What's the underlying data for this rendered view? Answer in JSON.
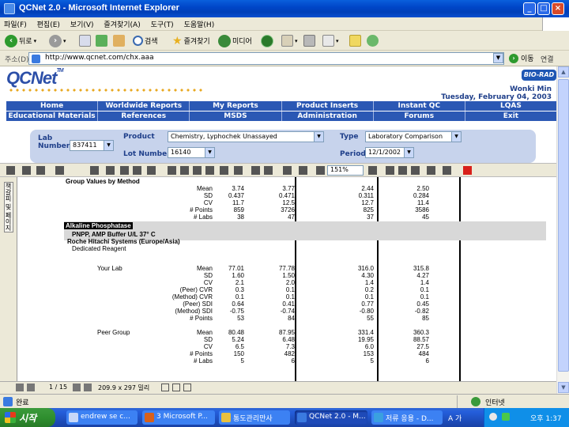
{
  "window": {
    "title": "QCNet 2.0 - Microsoft Internet Explorer"
  },
  "menu": [
    "파일(F)",
    "편집(E)",
    "보기(V)",
    "즐겨찾기(A)",
    "도구(T)",
    "도움말(H)"
  ],
  "toolbar": {
    "back": "뒤로",
    "search": "검색",
    "favorites": "즐겨찾기",
    "media": "미디어"
  },
  "address": {
    "label": "주소(D)",
    "url": "http://www.qcnet.com/chx.aaa",
    "go": "이동",
    "links": "연결"
  },
  "site": {
    "logo": "QCNet",
    "brand": "BIO-RAD",
    "user_name": "Wonki Min",
    "user_date": "Tuesday, February 04, 2003"
  },
  "nav1": [
    "Home",
    "Worldwide Reports",
    "My Reports",
    "Product Inserts",
    "Instant QC",
    "LQAS"
  ],
  "nav2": [
    "Educational Materials",
    "References",
    "MSDS",
    "Administration",
    "Forums",
    "Exit"
  ],
  "filter": {
    "lab_label": "Lab Number",
    "lab_value": "837411",
    "product_label": "Product",
    "product_value": "Chemistry, Lyphochek Unassayed",
    "lot_label": "Lot Number",
    "lot_value": "16140",
    "type_label": "Type",
    "type_value": "Laboratory Comparison",
    "period_label": "Period",
    "period_value": "12/1/2002"
  },
  "acro": {
    "zoom": "151%"
  },
  "bookmarks_tab": "책갈피 및 페이지",
  "report": {
    "group_header": "Group Values by Method",
    "top_stats": [
      "Mean",
      "SD",
      "CV",
      "# Points",
      "# Labs"
    ],
    "top_cols": [
      [
        "3.74",
        "0.437",
        "11.7",
        "859",
        "38"
      ],
      [
        "3.77",
        "0.471",
        "12.5",
        "3726",
        "47"
      ],
      [
        "2.44",
        "0.311",
        "12.7",
        "825",
        "37"
      ],
      [
        "2.50",
        "0.284",
        "11.4",
        "3586",
        "45"
      ]
    ],
    "analyte": "Alkaline Phosphatase",
    "method_line": "PNPP, AMP Buffer   U/L   37° C",
    "instrument": "Roche Hitachi Systems (Europe/Asia)",
    "reagent": "Dedicated Reagent",
    "your_lab_label": "Your Lab",
    "your_lab_stats": [
      "Mean",
      "SD",
      "CV",
      "(Peer) CVR",
      "(Method) CVR",
      "(Peer) SDI",
      "(Method) SDI",
      "# Points"
    ],
    "your_lab_cols": [
      [
        "77.01",
        "1.60",
        "2.1",
        "0.3",
        "0.1",
        "0.64",
        "-0.75",
        "53"
      ],
      [
        "77.78",
        "1.50",
        "2.0",
        "0.1",
        "0.1",
        "0.41",
        "-0.74",
        "84"
      ],
      [
        "316.0",
        "4.30",
        "1.4",
        "0.2",
        "0.1",
        "0.77",
        "-0.80",
        "55"
      ],
      [
        "315.8",
        "4.27",
        "1.4",
        "0.1",
        "0.1",
        "0.45",
        "-0.82",
        "85"
      ]
    ],
    "peer_label": "Peer Group",
    "peer_stats": [
      "Mean",
      "SD",
      "CV",
      "# Points",
      "# Labs"
    ],
    "peer_cols": [
      [
        "80.48",
        "5.24",
        "6.5",
        "150",
        "5"
      ],
      [
        "87.95",
        "6.48",
        "7.3",
        "482",
        "6"
      ],
      [
        "331.4",
        "19.95",
        "6.0",
        "153",
        "5"
      ],
      [
        "360.3",
        "88.57",
        "27.5",
        "484",
        "6"
      ]
    ]
  },
  "pdf_status": {
    "page": "1 / 15",
    "size": "209.9 x 297 밀리"
  },
  "status": {
    "left": "완료",
    "right": "인터넷"
  },
  "taskbar": {
    "start": "시작",
    "tasks": [
      "endrew se c...",
      "3 Microsoft P...",
      "통도관리만사",
      "QCNet 2.0 - M...",
      "저류 응용 - D..."
    ],
    "tray_lang": "A 가",
    "clock": "오후 1:37"
  },
  "colors": {
    "nav_blue": "#2b58b4",
    "filter_bg": "#c7d3ec",
    "logo_blue": "#2c4fa8"
  }
}
